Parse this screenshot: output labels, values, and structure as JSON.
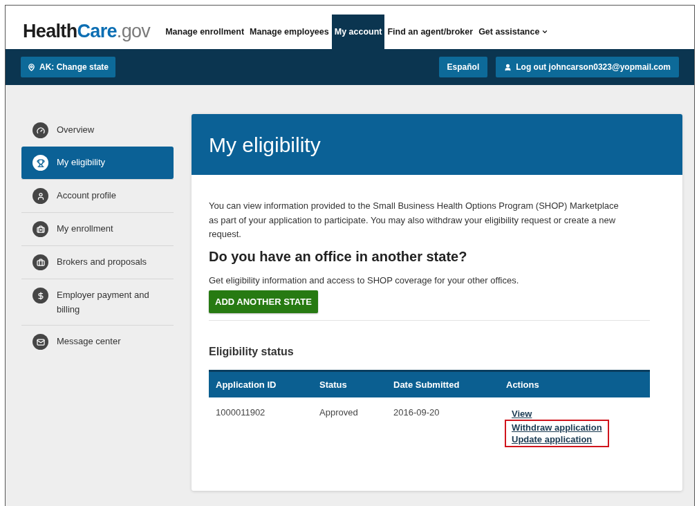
{
  "logo": {
    "parts": [
      "Health",
      "Care",
      ".gov"
    ]
  },
  "nav": [
    {
      "label": "Manage enrollment",
      "selected": false,
      "dropdown": false
    },
    {
      "label": "Manage employees",
      "selected": false,
      "dropdown": false
    },
    {
      "label": "My account",
      "selected": true,
      "dropdown": false
    },
    {
      "label": "Find an agent/broker",
      "selected": false,
      "dropdown": false
    },
    {
      "label": "Get assistance",
      "selected": false,
      "dropdown": true
    }
  ],
  "toolbar": {
    "state_button": "AK: Change state",
    "language_button": "Español",
    "logout_button": "Log out johncarson0323@yopmail.com"
  },
  "sidebar": {
    "items": [
      {
        "label": "Overview",
        "selected": false
      },
      {
        "label": "My eligibility",
        "selected": true
      },
      {
        "label": "Account profile",
        "selected": false
      },
      {
        "label": "My enrollment",
        "selected": false
      },
      {
        "label": "Brokers and proposals",
        "selected": false
      },
      {
        "label": "Employer payment and billing",
        "selected": false
      },
      {
        "label": "Message center",
        "selected": false
      }
    ]
  },
  "main": {
    "title": "My eligibility",
    "intro": "You can view information provided to the Small Business Health Options Program (SHOP) Marketplace as part of your application to participate. You may also withdraw your eligibility request or create a new request.",
    "office_heading": "Do you have an office in another state?",
    "office_text": "Get eligibility information and access to SHOP coverage for your other offices.",
    "add_button": "ADD ANOTHER STATE",
    "status_heading": "Eligibility status",
    "table": {
      "columns": [
        "Application ID",
        "Status",
        "Date Submitted",
        "Actions"
      ],
      "rows": [
        {
          "cells": [
            "1000011902",
            "Approved",
            "2016-09-20"
          ],
          "actions": [
            {
              "label": "View",
              "highlighted": false
            },
            {
              "label": "Withdraw application",
              "highlighted": true
            },
            {
              "label": "Update application",
              "highlighted": true
            }
          ]
        }
      ]
    }
  }
}
